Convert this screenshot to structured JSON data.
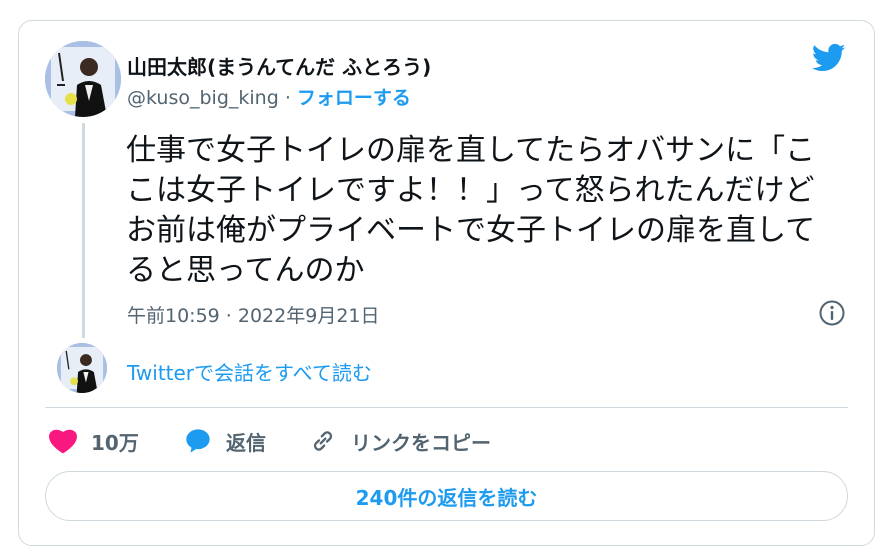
{
  "author": {
    "name": "山田太郎(まうんてんだ ふとろう)",
    "handle": "@kuso_big_king",
    "separator": " · ",
    "follow_label": "フォローする"
  },
  "tweet": {
    "text": "仕事で女子トイレの扉を直してたらオバサンに「こ\nこは女子トイレですよ！！」って怒られたんだけど\nお前は俺がプライベートで女子トイレの扉を直して\nると思ってんのか",
    "timestamp": "午前10:59 · 2022年9月21日"
  },
  "conversation_link": "Twitterで会話をすべて読む",
  "actions": {
    "like_count": "10万",
    "reply_label": "返信",
    "copy_link_label": "リンクをコピー"
  },
  "read_replies_label": "240件の返信を読む",
  "icons": {
    "brand": "twitter-bird-icon",
    "info": "info-icon",
    "like": "heart-icon",
    "reply": "speech-bubble-icon",
    "link": "link-icon"
  },
  "colors": {
    "accent": "#1d9bf0",
    "like": "#f91880",
    "muted": "#536471",
    "border": "#cfd9de"
  }
}
